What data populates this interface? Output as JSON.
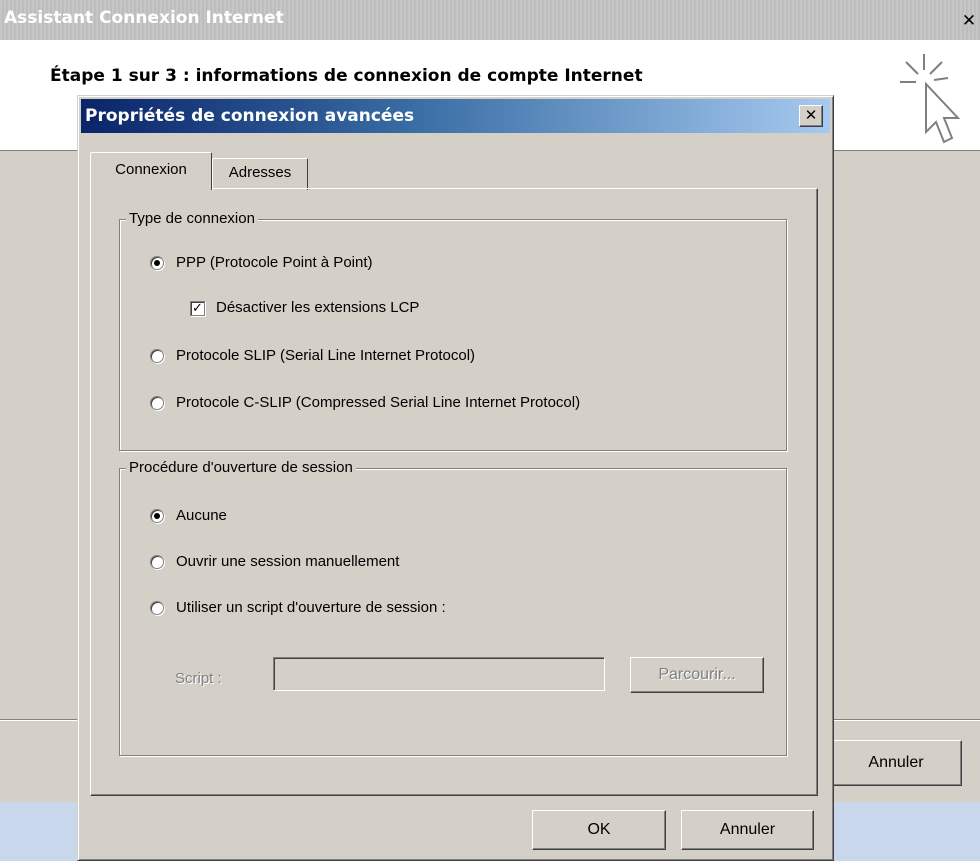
{
  "wizard": {
    "title": "Assistant Connexion Internet",
    "close_glyph": "✕",
    "step_heading": "Étape 1 sur 3 : informations de connexion de compte Internet",
    "cancel_label": "Annuler"
  },
  "dialog": {
    "title": "Propriétés de connexion avancées",
    "close_glyph": "✕",
    "tabs": [
      {
        "label": "Connexion",
        "selected": true
      },
      {
        "label": "Adresses",
        "selected": false
      }
    ],
    "connection_type": {
      "legend": "Type de connexion",
      "options": [
        {
          "label": "PPP (Protocole Point à Point)",
          "selected": true
        },
        {
          "label": "Protocole SLIP (Serial Line Internet Protocol)",
          "selected": false
        },
        {
          "label": "Protocole C-SLIP (Compressed Serial Line Internet Protocol)",
          "selected": false
        }
      ],
      "lcp_checkbox": {
        "label": "Désactiver les extensions LCP",
        "checked": true,
        "mark": "✓"
      }
    },
    "logon": {
      "legend": "Procédure d'ouverture de session",
      "options": [
        {
          "label": "Aucune",
          "selected": true
        },
        {
          "label": "Ouvrir une session manuellement",
          "selected": false
        },
        {
          "label": "Utiliser un script d'ouverture de session :",
          "selected": false
        }
      ],
      "script_label": "Script :",
      "script_value": "",
      "browse_label": "Parcourir..."
    },
    "ok_label": "OK",
    "cancel_label": "Annuler"
  }
}
